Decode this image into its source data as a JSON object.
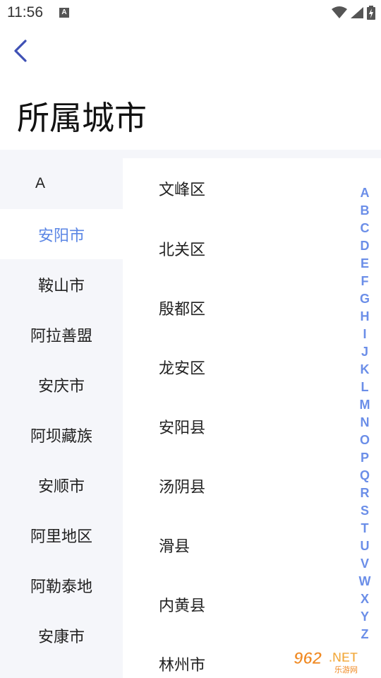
{
  "status_bar": {
    "time": "11:56",
    "app_icon_letter": "A"
  },
  "header": {
    "back_icon": "chevron-left-icon",
    "title": "所属城市"
  },
  "sidebar": {
    "group_letter": "A",
    "items": [
      {
        "label": "安阳市",
        "active": true
      },
      {
        "label": "鞍山市",
        "active": false
      },
      {
        "label": "阿拉善盟",
        "active": false
      },
      {
        "label": "安庆市",
        "active": false
      },
      {
        "label": "阿坝藏族",
        "active": false
      },
      {
        "label": "安顺市",
        "active": false
      },
      {
        "label": "阿里地区",
        "active": false
      },
      {
        "label": "阿勒泰地",
        "active": false
      },
      {
        "label": "安康市",
        "active": false
      }
    ]
  },
  "districts": [
    "文峰区",
    "北关区",
    "殷都区",
    "龙安区",
    "安阳县",
    "汤阴县",
    "滑县",
    "内黄县",
    "林州市"
  ],
  "alpha_index": [
    "A",
    "B",
    "C",
    "D",
    "E",
    "F",
    "G",
    "H",
    "I",
    "J",
    "K",
    "L",
    "M",
    "N",
    "O",
    "P",
    "Q",
    "R",
    "S",
    "T",
    "U",
    "V",
    "W",
    "X",
    "Y",
    "Z"
  ],
  "colors": {
    "accent": "#5b86e5",
    "index_letters": "#6b8ee8",
    "sidebar_bg": "#f5f6fa",
    "back_arrow": "#3f51b5"
  }
}
